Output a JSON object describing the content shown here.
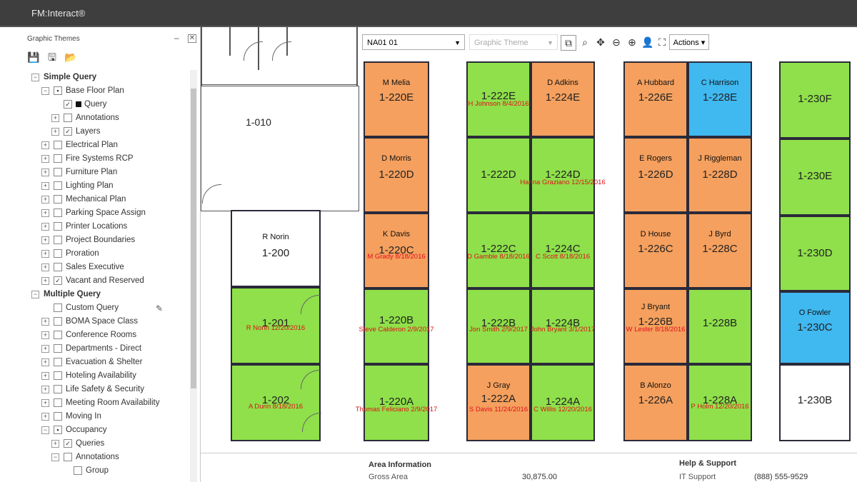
{
  "app": {
    "title": "FM:Interact®"
  },
  "left_panel": {
    "title": "Graphic Themes",
    "minimize": "–",
    "close": "✕",
    "tools": [
      {
        "name": "save-icon",
        "glyph": "💾"
      },
      {
        "name": "save-as-icon",
        "glyph": "🖫"
      },
      {
        "name": "open-folder-icon",
        "glyph": "📂"
      }
    ],
    "tree": [
      {
        "label": "Simple Query",
        "level": 0,
        "exp": "−",
        "cb": false,
        "bold": true
      },
      {
        "label": "Base Floor Plan",
        "level": 1,
        "exp": "−",
        "cb": "▪"
      },
      {
        "label": "Query",
        "level": 2,
        "exp": "",
        "cb": "✓",
        "swatch": true
      },
      {
        "label": "Annotations",
        "level": 2,
        "exp": "+",
        "cb": ""
      },
      {
        "label": "Layers",
        "level": 2,
        "exp": "+",
        "cb": "✓"
      },
      {
        "label": "Electrical Plan",
        "level": 1,
        "exp": "+",
        "cb": ""
      },
      {
        "label": "Fire Systems RCP",
        "level": 1,
        "exp": "+",
        "cb": ""
      },
      {
        "label": "Furniture Plan",
        "level": 1,
        "exp": "+",
        "cb": ""
      },
      {
        "label": "Lighting Plan",
        "level": 1,
        "exp": "+",
        "cb": ""
      },
      {
        "label": "Mechanical Plan",
        "level": 1,
        "exp": "+",
        "cb": ""
      },
      {
        "label": "Parking Space Assign",
        "level": 1,
        "exp": "+",
        "cb": ""
      },
      {
        "label": "Printer Locations",
        "level": 1,
        "exp": "+",
        "cb": ""
      },
      {
        "label": "Project Boundaries",
        "level": 1,
        "exp": "+",
        "cb": ""
      },
      {
        "label": "Proration",
        "level": 1,
        "exp": "+",
        "cb": ""
      },
      {
        "label": "Sales Executive",
        "level": 1,
        "exp": "+",
        "cb": ""
      },
      {
        "label": "Vacant and Reserved",
        "level": 1,
        "exp": "+",
        "cb": "✓"
      },
      {
        "label": "Multiple Query",
        "level": 0,
        "exp": "−",
        "cb": false,
        "bold": true
      },
      {
        "label": "Custom Query",
        "level": 1,
        "exp": "",
        "cb": ""
      },
      {
        "label": "BOMA Space Class",
        "level": 1,
        "exp": "+",
        "cb": ""
      },
      {
        "label": "Conference Rooms",
        "level": 1,
        "exp": "+",
        "cb": ""
      },
      {
        "label": "Departments - Direct",
        "level": 1,
        "exp": "+",
        "cb": ""
      },
      {
        "label": "Evacuation & Shelter",
        "level": 1,
        "exp": "+",
        "cb": ""
      },
      {
        "label": "Hoteling Availability",
        "level": 1,
        "exp": "+",
        "cb": ""
      },
      {
        "label": "Life Safety & Security",
        "level": 1,
        "exp": "+",
        "cb": ""
      },
      {
        "label": "Meeting Room Availability",
        "level": 1,
        "exp": "+",
        "cb": ""
      },
      {
        "label": "Moving In",
        "level": 1,
        "exp": "+",
        "cb": ""
      },
      {
        "label": "Occupancy",
        "level": 1,
        "exp": "−",
        "cb": "▪"
      },
      {
        "label": "Queries",
        "level": 2,
        "exp": "+",
        "cb": "✓"
      },
      {
        "label": "Annotations",
        "level": 2,
        "exp": "−",
        "cb": ""
      },
      {
        "label": "Group",
        "level": 3,
        "exp": "",
        "cb": ""
      }
    ]
  },
  "toolbar": {
    "floor_select": "NA01 01",
    "theme_placeholder": "Graphic Theme",
    "actions_label": "Actions"
  },
  "rooms": [
    {
      "id": "1-010",
      "occ": "",
      "num": "1-010",
      "color": "white",
      "note": ""
    },
    {
      "id": "1-200",
      "occ": "R Norin",
      "num": "1-200",
      "color": "white",
      "note": ""
    },
    {
      "id": "1-201",
      "occ": "",
      "num": "1-201",
      "color": "green",
      "note": "R Norin 12/20/2016"
    },
    {
      "id": "1-202",
      "occ": "",
      "num": "1-202",
      "color": "green",
      "note": "A Dunn 8/18/2016"
    },
    {
      "id": "1-220E",
      "occ": "M Melia",
      "num": "1-220E",
      "color": "orange",
      "note": ""
    },
    {
      "id": "1-220D",
      "occ": "D Morris",
      "num": "1-220D",
      "color": "orange",
      "note": ""
    },
    {
      "id": "1-220C",
      "occ": "K Davis",
      "num": "1-220C",
      "color": "orange",
      "note": "M Grady 8/18/2016"
    },
    {
      "id": "1-220B",
      "occ": "",
      "num": "1-220B",
      "color": "green",
      "note": "Steve Calderon 2/9/2017"
    },
    {
      "id": "1-220A",
      "occ": "",
      "num": "1-220A",
      "color": "green",
      "note": "Thomas Feliciano 2/9/2017"
    },
    {
      "id": "1-222E",
      "occ": "",
      "num": "1-222E",
      "color": "green",
      "note": "H Johnson 8/4/2016"
    },
    {
      "id": "1-222D",
      "occ": "",
      "num": "1-222D",
      "color": "green",
      "note": ""
    },
    {
      "id": "1-222C",
      "occ": "",
      "num": "1-222C",
      "color": "green",
      "note": "D Gamble 8/18/2016"
    },
    {
      "id": "1-222B",
      "occ": "",
      "num": "1-222B",
      "color": "green",
      "note": "Jon Smith 2/9/2017"
    },
    {
      "id": "1-222A",
      "occ": "J Gray",
      "num": "1-222A",
      "color": "orange",
      "note": "S Davis 11/24/2016"
    },
    {
      "id": "1-224E",
      "occ": "D Adkins",
      "num": "1-224E",
      "color": "orange",
      "note": ""
    },
    {
      "id": "1-224D",
      "occ": "",
      "num": "1-224D",
      "color": "green",
      "note": "Hanna Graziano 12/15/2016"
    },
    {
      "id": "1-224C",
      "occ": "",
      "num": "1-224C",
      "color": "green",
      "note": "C Scott 8/18/2016"
    },
    {
      "id": "1-224B",
      "occ": "",
      "num": "1-224B",
      "color": "green",
      "note": "John Bryant 3/1/2017"
    },
    {
      "id": "1-224A",
      "occ": "",
      "num": "1-224A",
      "color": "green",
      "note": "C Willis 12/20/2016"
    },
    {
      "id": "1-226E",
      "occ": "A Hubbard",
      "num": "1-226E",
      "color": "orange",
      "note": ""
    },
    {
      "id": "1-226D",
      "occ": "E Rogers",
      "num": "1-226D",
      "color": "orange",
      "note": ""
    },
    {
      "id": "1-226C",
      "occ": "D House",
      "num": "1-226C",
      "color": "orange",
      "note": ""
    },
    {
      "id": "1-226B",
      "occ": "J Bryant",
      "num": "1-226B",
      "color": "orange",
      "note": "W Lester 8/18/2016"
    },
    {
      "id": "1-226A",
      "occ": "B Alonzo",
      "num": "1-226A",
      "color": "orange",
      "note": ""
    },
    {
      "id": "1-228E",
      "occ": "C Harrison",
      "num": "1-228E",
      "color": "blue",
      "note": ""
    },
    {
      "id": "1-228D",
      "occ": "J Riggleman",
      "num": "1-228D",
      "color": "orange",
      "note": ""
    },
    {
      "id": "1-228C",
      "occ": "J Byrd",
      "num": "1-228C",
      "color": "orange",
      "note": ""
    },
    {
      "id": "1-228B",
      "occ": "",
      "num": "1-228B",
      "color": "green",
      "note": ""
    },
    {
      "id": "1-228A",
      "occ": "",
      "num": "1-228A",
      "color": "green",
      "note": "P Holm 12/20/2016"
    },
    {
      "id": "1-230F",
      "occ": "",
      "num": "1-230F",
      "color": "green",
      "note": ""
    },
    {
      "id": "1-230E",
      "occ": "",
      "num": "1-230E",
      "color": "green",
      "note": ""
    },
    {
      "id": "1-230D",
      "occ": "",
      "num": "1-230D",
      "color": "green",
      "note": ""
    },
    {
      "id": "1-230C",
      "occ": "O Fowler",
      "num": "1-230C",
      "color": "blue",
      "note": ""
    },
    {
      "id": "1-230B",
      "occ": "",
      "num": "1-230B",
      "color": "white",
      "note": ""
    }
  ],
  "bottom": {
    "area_title": "Area Information",
    "gross_area_label": "Gross Area",
    "gross_area_value": "30,875.00",
    "help_title": "Help & Support",
    "it_support_label": "IT Support",
    "it_support_value": "(888) 555-9529"
  },
  "colors": {
    "green": "#8fe04a",
    "orange": "#f5a05e",
    "blue": "#40b8f0"
  }
}
